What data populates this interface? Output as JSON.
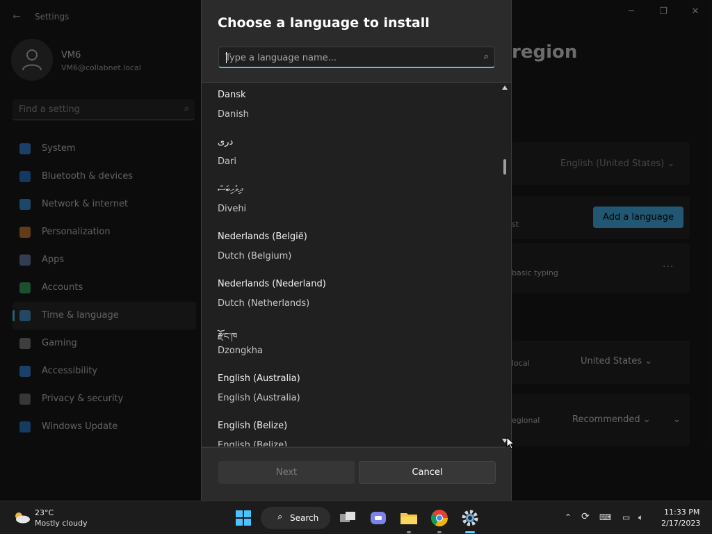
{
  "settings": {
    "app_title": "Settings",
    "window_controls": {
      "minimize": "─",
      "maximize": "❐",
      "close": "✕"
    },
    "profile": {
      "name": "VM6",
      "email": "VM6@collabnet.local"
    },
    "find_placeholder": "Find a setting",
    "nav": [
      {
        "label": "System",
        "color": "#3a8ee6"
      },
      {
        "label": "Bluetooth & devices",
        "color": "#2b7fd4"
      },
      {
        "label": "Network & internet",
        "color": "#3d9ee8"
      },
      {
        "label": "Personalization",
        "color": "#d9843b"
      },
      {
        "label": "Apps",
        "color": "#6f8bb0"
      },
      {
        "label": "Accounts",
        "color": "#3fae6b"
      },
      {
        "label": "Time & language",
        "color": "#4f9fd8"
      },
      {
        "label": "Gaming",
        "color": "#8a8a8a"
      },
      {
        "label": "Accessibility",
        "color": "#3a8ee6"
      },
      {
        "label": "Privacy & security",
        "color": "#7a7a7a"
      },
      {
        "label": "Windows Update",
        "color": "#2f86d6"
      }
    ],
    "active_nav": "Time & language",
    "page_title": "region",
    "background": {
      "display_lang_value": "English (United States)",
      "add_language_label": "Add a language",
      "card2_text": "st",
      "card3_text": "basic typing",
      "more_label": "···",
      "card4_text": "local",
      "country_value": "United States",
      "card5_text": "egional",
      "format_value": "Recommended"
    }
  },
  "modal": {
    "title": "Choose a language to install",
    "search_placeholder": "Type a language name...",
    "languages": [
      {
        "native": "Dansk",
        "english": "Danish"
      },
      {
        "native": "دری",
        "english": "Dari"
      },
      {
        "native": "ދިވެހިބަސް",
        "english": "Divehi"
      },
      {
        "native": "Nederlands (België)",
        "english": "Dutch (Belgium)"
      },
      {
        "native": "Nederlands (Nederland)",
        "english": "Dutch (Netherlands)"
      },
      {
        "native": "རྫོང་ཁ",
        "english": "Dzongkha"
      },
      {
        "native": "English (Australia)",
        "english": "English (Australia)"
      },
      {
        "native": "English (Belize)",
        "english": "English (Belize)"
      }
    ],
    "next_label": "Next",
    "cancel_label": "Cancel"
  },
  "taskbar": {
    "weather": {
      "temp": "23°C",
      "condition": "Mostly cloudy"
    },
    "search_label": "Search",
    "clock": {
      "time": "11:33 PM",
      "date": "2/17/2023"
    },
    "accent_color": "#60cdff"
  }
}
